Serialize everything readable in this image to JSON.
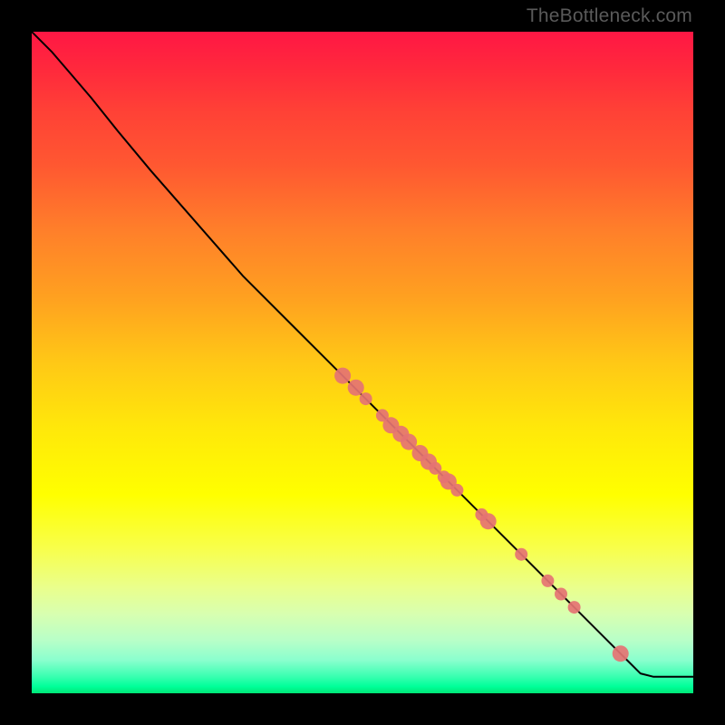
{
  "watermark": "TheBottleneck.com",
  "chart_data": {
    "type": "line",
    "title": "",
    "xlabel": "",
    "ylabel": "",
    "xlim": [
      0,
      100
    ],
    "ylim": [
      0,
      100
    ],
    "background": "rainbow-gradient-red-to-green",
    "curve": [
      {
        "x": 0,
        "y": 100
      },
      {
        "x": 3,
        "y": 97
      },
      {
        "x": 6,
        "y": 93.5
      },
      {
        "x": 9,
        "y": 90
      },
      {
        "x": 13,
        "y": 85
      },
      {
        "x": 18,
        "y": 79
      },
      {
        "x": 25,
        "y": 71
      },
      {
        "x": 32,
        "y": 63
      },
      {
        "x": 40,
        "y": 55
      },
      {
        "x": 48,
        "y": 47
      },
      {
        "x": 56,
        "y": 39
      },
      {
        "x": 64,
        "y": 31
      },
      {
        "x": 72,
        "y": 23
      },
      {
        "x": 80,
        "y": 15
      },
      {
        "x": 86,
        "y": 9
      },
      {
        "x": 90,
        "y": 5
      },
      {
        "x": 92,
        "y": 3
      },
      {
        "x": 94,
        "y": 2.5
      },
      {
        "x": 100,
        "y": 2.5
      }
    ],
    "markers": [
      {
        "x": 47,
        "y": 48,
        "r": 9
      },
      {
        "x": 49,
        "y": 46.2,
        "r": 9
      },
      {
        "x": 50.5,
        "y": 44.5,
        "r": 7
      },
      {
        "x": 53,
        "y": 42,
        "r": 7
      },
      {
        "x": 54.3,
        "y": 40.5,
        "r": 9
      },
      {
        "x": 55.8,
        "y": 39.2,
        "r": 9
      },
      {
        "x": 57,
        "y": 38,
        "r": 9
      },
      {
        "x": 58.7,
        "y": 36.3,
        "r": 9
      },
      {
        "x": 60,
        "y": 35,
        "r": 9
      },
      {
        "x": 61,
        "y": 34,
        "r": 7
      },
      {
        "x": 62.3,
        "y": 32.7,
        "r": 7
      },
      {
        "x": 63,
        "y": 32,
        "r": 9
      },
      {
        "x": 64.3,
        "y": 30.7,
        "r": 7
      },
      {
        "x": 68,
        "y": 27,
        "r": 7
      },
      {
        "x": 69,
        "y": 26,
        "r": 9
      },
      {
        "x": 74,
        "y": 21,
        "r": 7
      },
      {
        "x": 78,
        "y": 17,
        "r": 7
      },
      {
        "x": 80,
        "y": 15,
        "r": 7
      },
      {
        "x": 82,
        "y": 13,
        "r": 7
      },
      {
        "x": 89,
        "y": 6,
        "r": 9
      }
    ],
    "marker_color": "#e57373"
  }
}
